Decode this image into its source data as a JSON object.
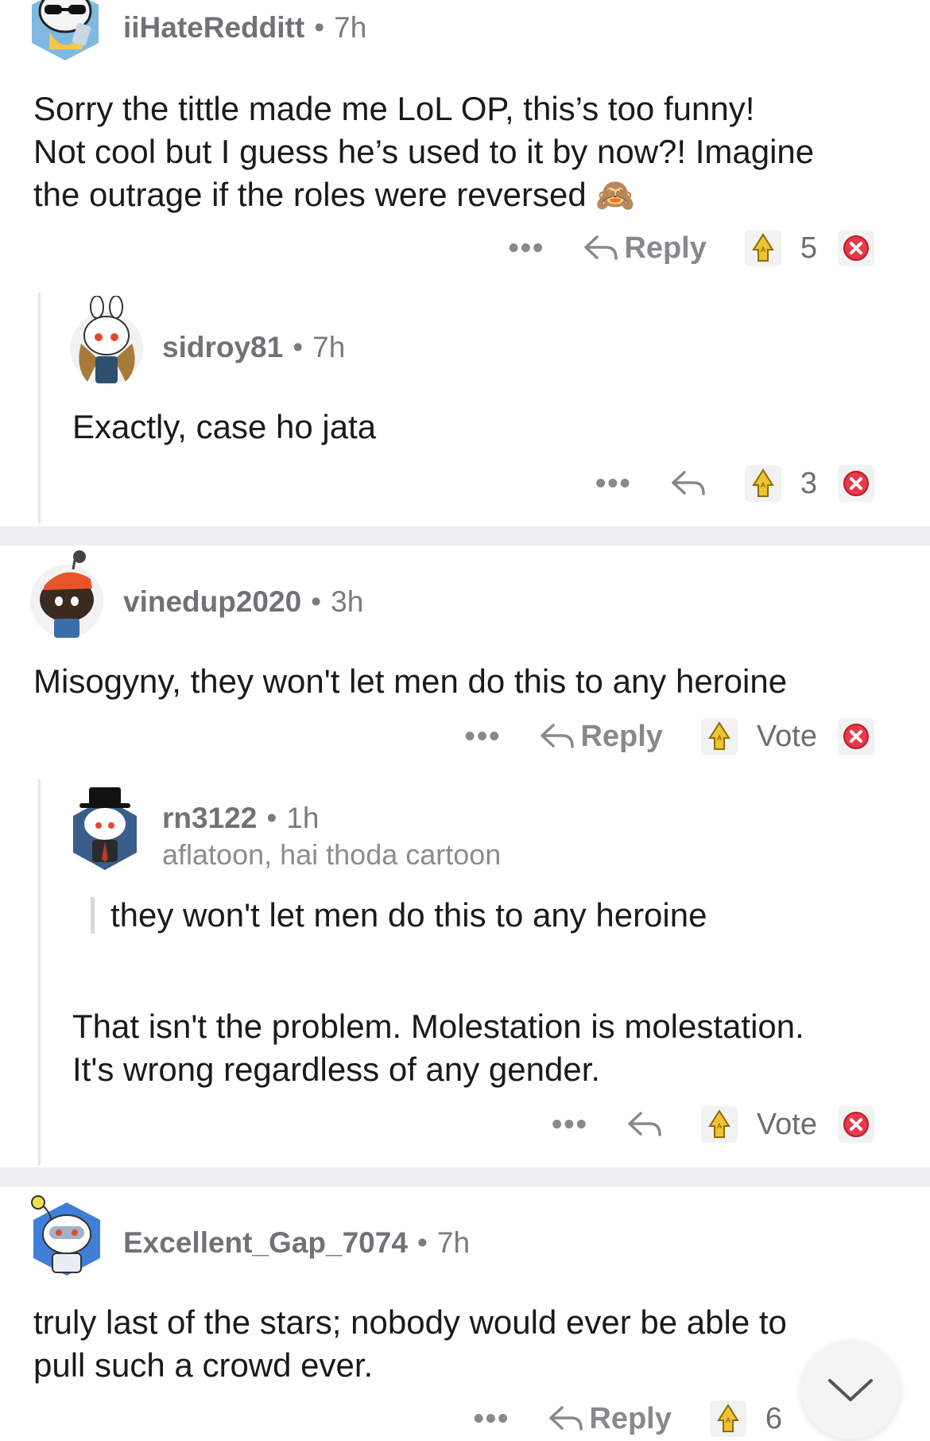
{
  "colors": {
    "thread_line": "#e4e6e8",
    "separator": "#edeff1",
    "meta": "#787c7e",
    "upvote_gold": "#e8b829",
    "downvote_red": "#e8394a"
  },
  "icons": {
    "more": "ellipsis-icon",
    "reply": "reply-arrow-icon",
    "upvote": "award-upvote-icon",
    "downvote": "downvote-icon",
    "scroll": "chevron-down-icon"
  },
  "comments": [
    {
      "user": "iiHateRedditt",
      "time": "7h",
      "body": [
        "Sorry the tittle made me LoL OP, this’s too funny!",
        "Not cool but I guess he’s used to it by now?! Imagine",
        "the outrage if the roles were reversed"
      ],
      "emoji": "🙈",
      "actions": {
        "more": "•••",
        "reply": "Reply",
        "score": "5"
      }
    },
    {
      "user": "sidroy81",
      "time": "7h",
      "body": [
        "Exactly, case ho jata"
      ],
      "actions": {
        "more": "•••",
        "score": "3"
      }
    },
    {
      "user": "vinedup2020",
      "time": "3h",
      "body": [
        "Misogyny, they won't let men do this to any heroine"
      ],
      "actions": {
        "more": "•••",
        "reply": "Reply",
        "score": "Vote"
      }
    },
    {
      "user": "rn3122",
      "time": "1h",
      "flair": "aflatoon, hai thoda cartoon",
      "quote": "they won't let men do this to any heroine",
      "body": [
        "That isn't the problem. Molestation is molestation.",
        "It's wrong regardless of any gender."
      ],
      "actions": {
        "more": "•••",
        "score": "Vote"
      }
    },
    {
      "user": "Excellent_Gap_7074",
      "time": "7h",
      "body": [
        "truly last of the stars; nobody would ever be able to",
        "pull such a crowd ever."
      ],
      "actions": {
        "more": "•••",
        "reply": "Reply",
        "score": "6"
      }
    }
  ],
  "separator_dot": "•"
}
